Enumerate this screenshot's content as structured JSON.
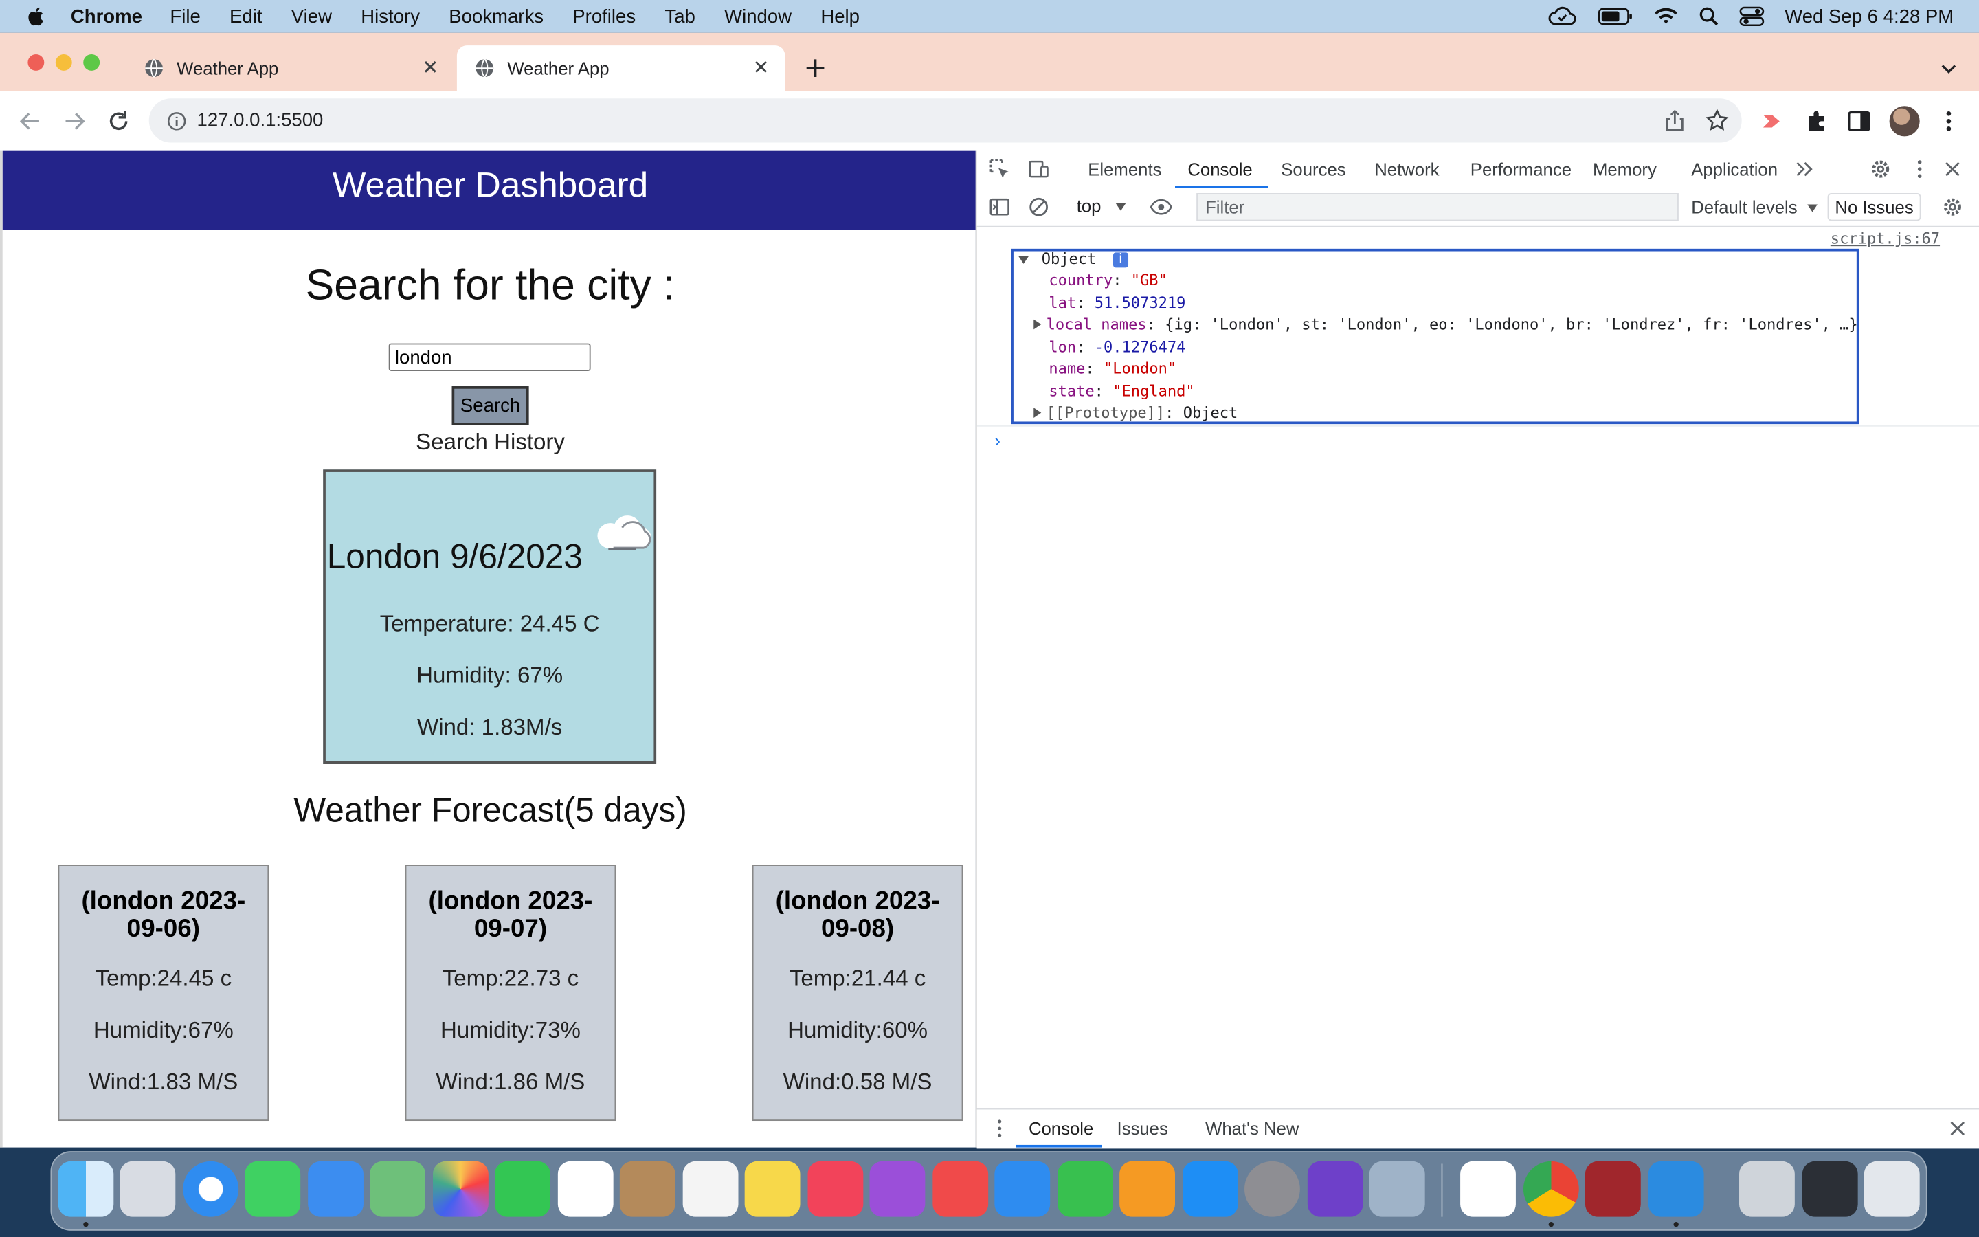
{
  "menubar": {
    "app_name": "Chrome",
    "items": [
      "File",
      "Edit",
      "View",
      "History",
      "Bookmarks",
      "Profiles",
      "Tab",
      "Window",
      "Help"
    ],
    "clock": "Wed Sep 6  4:28 PM"
  },
  "tabs": [
    {
      "title": "Weather App",
      "active": false
    },
    {
      "title": "Weather App",
      "active": true
    }
  ],
  "address_bar": {
    "url": "127.0.0.1:5500"
  },
  "page": {
    "header_title": "Weather Dashboard",
    "search_heading": "Search for the city :",
    "search_value": "london",
    "search_button": "Search",
    "history_label": "Search History",
    "today": {
      "city_date": "London 9/6/2023",
      "temperature": "Temperature: 24.45 C",
      "humidity": "Humidity: 67%",
      "wind": "Wind: 1.83M/s",
      "icon": "cloud-icon"
    },
    "forecast_title": "Weather Forecast(5 days)",
    "forecast": [
      {
        "title": "(london 2023-09-06)",
        "temp": "Temp:24.45 c",
        "humidity": "Humidity:67%",
        "wind": "Wind:1.83 M/S"
      },
      {
        "title": "(london 2023-09-07)",
        "temp": "Temp:22.73 c",
        "humidity": "Humidity:73%",
        "wind": "Wind:1.86 M/S"
      },
      {
        "title": "(london 2023-09-08)",
        "temp": "Temp:21.44 c",
        "humidity": "Humidity:60%",
        "wind": "Wind:0.58 M/S"
      }
    ]
  },
  "devtools": {
    "tabs": [
      "Elements",
      "Console",
      "Sources",
      "Network",
      "Performance",
      "Memory",
      "Application"
    ],
    "active_tab": "Console",
    "context": "top",
    "filter_placeholder": "Filter",
    "levels": "Default levels",
    "issues": "No Issues",
    "source_link": "script.js:67",
    "object": {
      "label": "Object",
      "country_key": "country",
      "country_val": "\"GB\"",
      "lat_key": "lat",
      "lat_val": "51.5073219",
      "local_names_key": "local_names",
      "local_names_val": "{ig: 'London', st: 'London', eo: 'Londono', br: 'Londrez', fr: 'Londres', …}",
      "lon_key": "lon",
      "lon_val": "-0.1276474",
      "name_key": "name",
      "name_val": "\"London\"",
      "state_key": "state",
      "state_val": "\"England\"",
      "proto_key": "[[Prototype]]",
      "proto_val": "Object"
    },
    "prompt": "›",
    "drawer_tabs": [
      "Console",
      "Issues",
      "What's New"
    ]
  },
  "colors": {
    "header_bg": "#24248a",
    "today_card_bg": "#b3dbe3",
    "forecast_card_bg": "#cbd1da",
    "tabstrip_bg": "#f8d9cd",
    "accent": "#1a73e8"
  }
}
